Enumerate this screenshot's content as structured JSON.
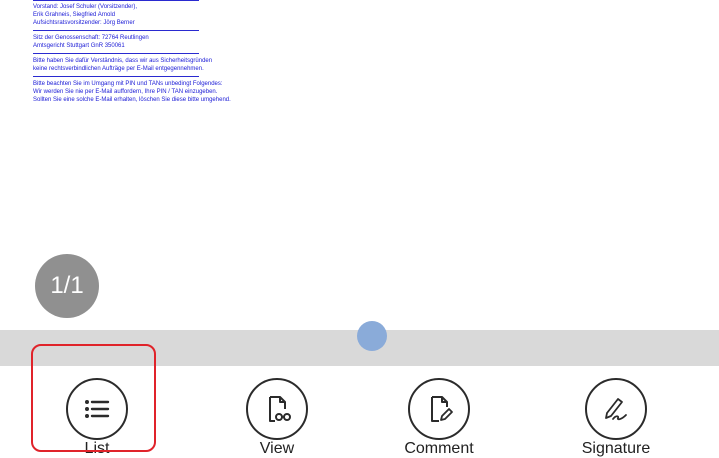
{
  "document": {
    "lines": [
      "Vorstand: Josef Schuler (Vorsitzender),",
      "Erik Grahneis, Siegfried Arnold",
      "Aufsichtsratsvorsitzender: Jörg Berner",
      "Sitz der Genossenschaft: 72764 Reutlingen",
      "Amtsgericht Stuttgart GnR 350061",
      "Bitte haben Sie dafür Verständnis, dass wir aus Sicherheitsgründen",
      "keine rechtsverbindlichen Aufträge per E-Mail entgegennehmen.",
      "Bitte beachten Sie im Umgang mit PIN und TANs unbedingt Folgendes:",
      "Wir werden Sie nie per E-Mail auffordern, Ihre PIN / TAN einzugeben.",
      "Sollten Sie eine solche E-Mail erhalten, löschen Sie diese bitte umgehend."
    ],
    "text_color": "#1a1ad6"
  },
  "page_indicator": {
    "text": "1/1"
  },
  "toolbar": {
    "list_label": "List",
    "view_label": "View",
    "comment_label": "Comment",
    "signature_label": "Signature"
  },
  "colors": {
    "highlight": "#e0232a",
    "scrubber_track": "#d9d9d9",
    "scrubber_thumb": "#8aabd9",
    "page_indicator_bg": "#909090"
  }
}
